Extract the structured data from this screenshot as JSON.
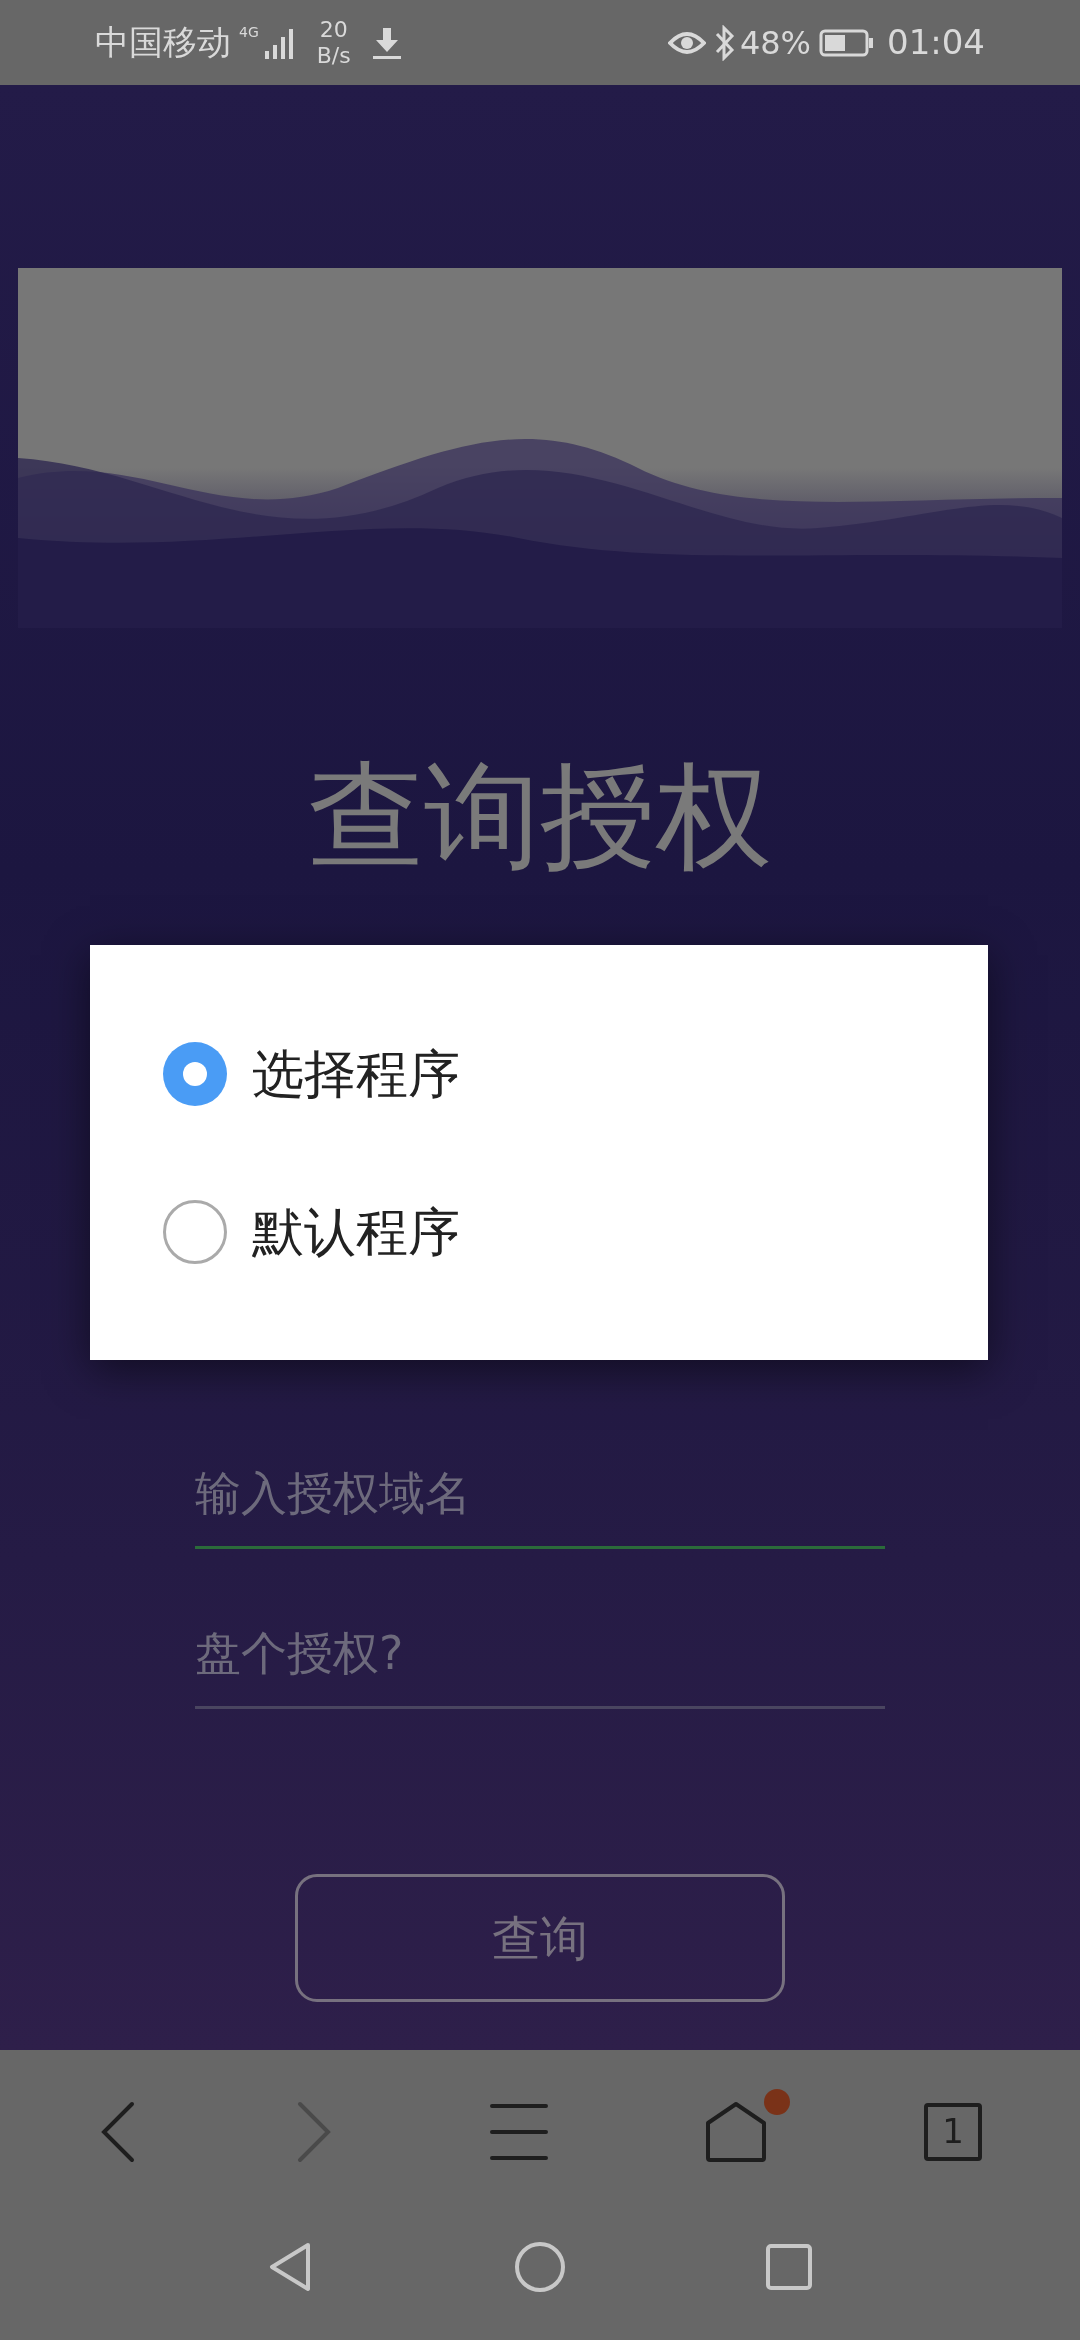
{
  "status_bar": {
    "carrier": "中国移动",
    "network": "4G",
    "speed_value": "20",
    "speed_unit": "B/s",
    "battery": "48%",
    "time": "01:04"
  },
  "page": {
    "title": "查询授权",
    "fields": [
      {
        "placeholder": "输入授权域名",
        "focused": true
      },
      {
        "placeholder": "盘个授权?",
        "focused": false
      }
    ],
    "button": "查询"
  },
  "dialog": {
    "options": [
      {
        "label": "选择程序",
        "selected": true
      },
      {
        "label": "默认程序",
        "selected": false
      }
    ]
  },
  "browser_bar": {
    "back": {
      "disabled": false
    },
    "forward": {
      "disabled": true
    },
    "home_badge": true,
    "tab_count": "1"
  }
}
